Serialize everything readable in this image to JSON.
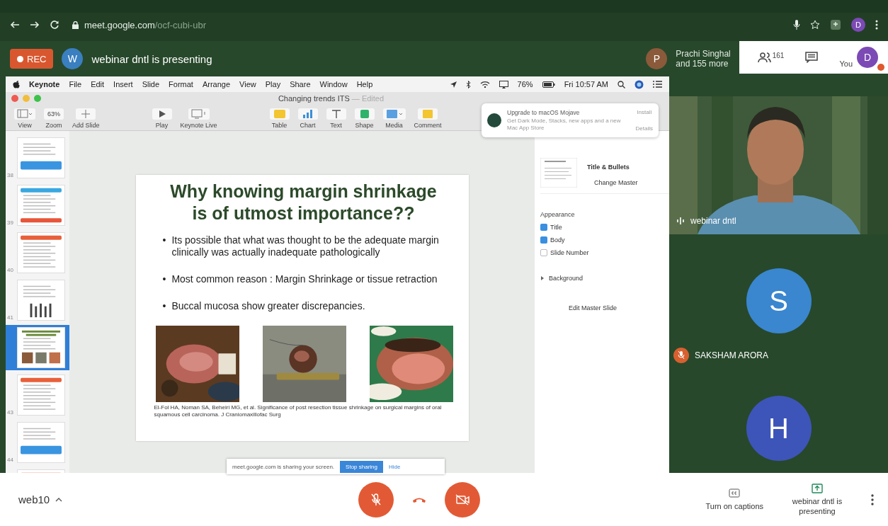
{
  "browser": {
    "url_host": "meet.google.com",
    "url_path": "/ocf-cubi-ubr",
    "profile_initial": "D"
  },
  "meeting_header": {
    "recording_label": "REC",
    "presenter_initial": "W",
    "presenter_status": "webinar dntl is presenting",
    "participant_initial": "P",
    "participant_name": "Prachi Singhal",
    "participant_more": "and 155 more",
    "people_count": "161",
    "self_label": "You",
    "self_initial": "D"
  },
  "shared_screen": {
    "menu": [
      "Keynote",
      "File",
      "Edit",
      "Insert",
      "Slide",
      "Format",
      "Arrange",
      "View",
      "Play",
      "Share",
      "Window",
      "Help"
    ],
    "battery": "76%",
    "clock": "Fri 10:57 AM",
    "document_title": "Changing trends ITS",
    "document_status": "— Edited",
    "toolbar": [
      {
        "kind": "view",
        "label": "View"
      },
      {
        "kind": "zoom",
        "label": "Zoom",
        "value": "63%"
      },
      {
        "kind": "add",
        "label": "Add Slide"
      },
      {
        "kind": "gap"
      },
      {
        "kind": "play",
        "label": "Play"
      },
      {
        "kind": "live",
        "label": "Keynote Live"
      },
      {
        "kind": "gap"
      },
      {
        "kind": "table",
        "label": "Table"
      },
      {
        "kind": "chart",
        "label": "Chart"
      },
      {
        "kind": "text",
        "label": "Text"
      },
      {
        "kind": "shape",
        "label": "Shape"
      },
      {
        "kind": "media",
        "label": "Media"
      },
      {
        "kind": "comment",
        "label": "Comment"
      }
    ],
    "slides": [
      {
        "number": "38",
        "kind": "banner",
        "selected": false
      },
      {
        "number": "39",
        "kind": "list",
        "selected": false
      },
      {
        "number": "40",
        "kind": "text",
        "selected": false
      },
      {
        "number": "41",
        "kind": "chart",
        "selected": false
      },
      {
        "kind": "photos",
        "selected": true
      },
      {
        "number": "43",
        "kind": "text",
        "selected": false
      },
      {
        "number": "44",
        "kind": "banner",
        "selected": false
      },
      {
        "kind": "text",
        "selected": false
      }
    ],
    "slide": {
      "title": "Why knowing margin shrinkage is of utmost importance??",
      "bullet_marker": "•",
      "bullets": [
        "Its possible that what was thought to be the adequate margin clinically was actually inadequate pathologically",
        "Most common reason : Margin Shrinkage or tissue retraction",
        "Buccal mucosa show greater discrepancies."
      ],
      "citation": "El-Fol HA, Noman SA, Beheiri MG, et al. Significance of post resection tissue shrinkage on surgical margins of oral squamous cell carcinoma. J Craniomaxillofac Surg"
    },
    "inspector": {
      "layout_name": "Title & Bullets",
      "change_master": "Change Master",
      "appearance_heading": "Appearance",
      "options": [
        {
          "label": "Title",
          "checked": true
        },
        {
          "label": "Body",
          "checked": true
        },
        {
          "label": "Slide Number",
          "checked": false
        }
      ],
      "background": "Background",
      "background_expanded": false,
      "edit_master": "Edit Master Slide"
    },
    "notification": {
      "title": "Upgrade to macOS Mojave",
      "body": "Get Dark Mode, Stacks, new apps and a new Mac App Store",
      "actions": [
        "Install",
        "Details"
      ]
    },
    "sharing_bar": {
      "message": "meet.google.com is sharing your screen.",
      "stop": "Stop sharing",
      "hide": "Hide"
    }
  },
  "tiles": [
    {
      "kind": "video",
      "name": "webinar dntl"
    },
    {
      "kind": "avatar",
      "initial": "S",
      "name": "SAKSHAM ARORA",
      "muted": true,
      "color": "#3a86cf"
    },
    {
      "kind": "avatar",
      "initial": "H",
      "color": "#3d55b8"
    }
  ],
  "footer": {
    "meeting_code": "web10",
    "mic_muted": true,
    "camera_off": true,
    "captions_label": "Turn on captions",
    "presenting_label": "webinar dntl is presenting"
  }
}
